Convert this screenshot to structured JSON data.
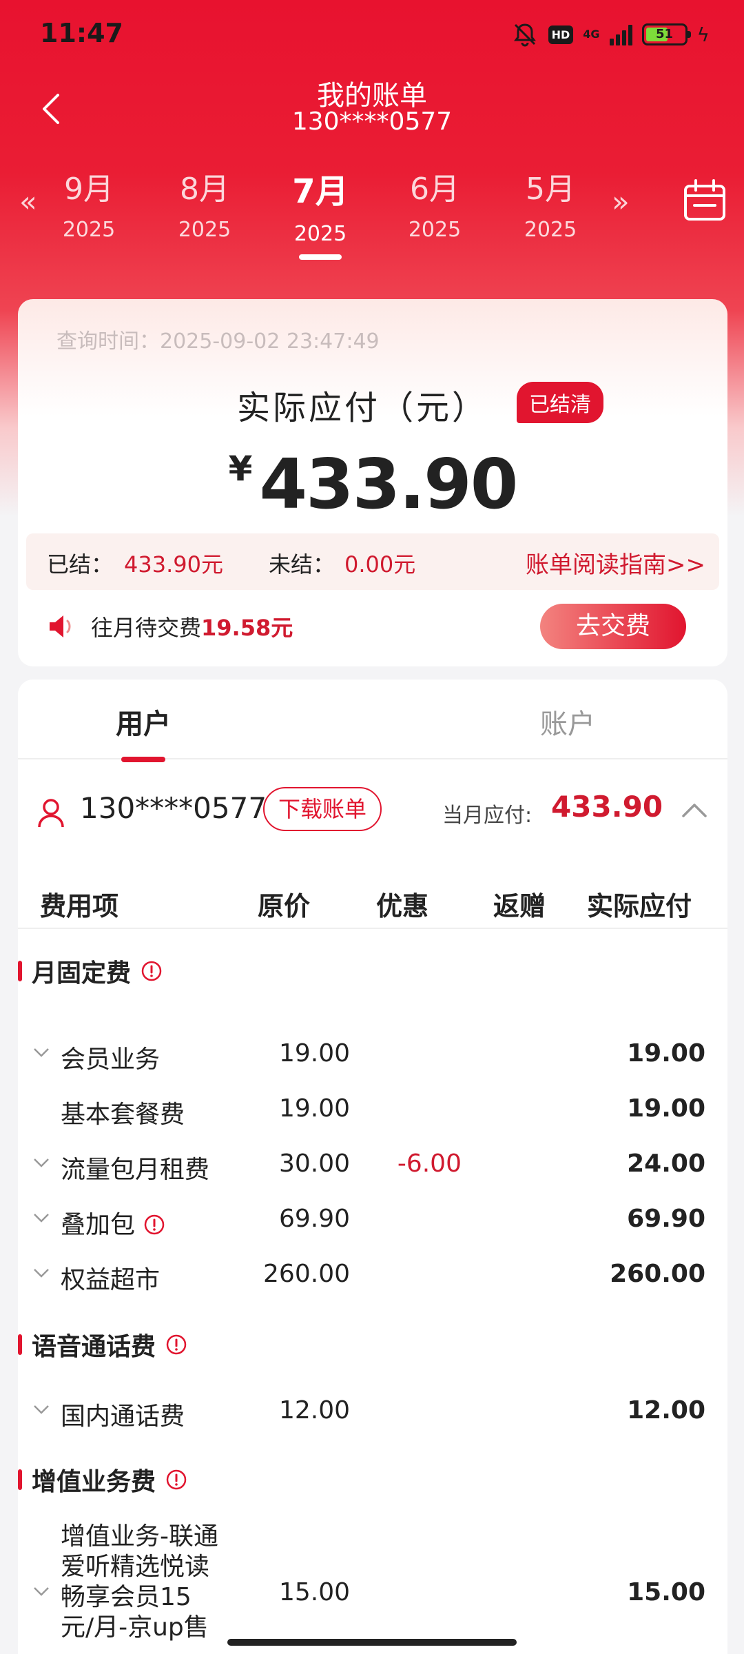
{
  "status": {
    "time": "11:47",
    "hd": "HD",
    "network": "4G",
    "battery": "51"
  },
  "header": {
    "title": "我的账单",
    "subtitle": "130****0577"
  },
  "months": [
    {
      "month": "9月",
      "year": "2025"
    },
    {
      "month": "8月",
      "year": "2025"
    },
    {
      "month": "7月",
      "year": "2025"
    },
    {
      "month": "6月",
      "year": "2025"
    },
    {
      "month": "5月",
      "year": "2025"
    }
  ],
  "nav": {
    "prev": "«",
    "next": "»"
  },
  "summary": {
    "query_time": "查询时间：2025-09-02 23:47:49",
    "pay_label": "实际应付（元）",
    "status_badge": "已结清",
    "currency": "¥",
    "amount": "433.90",
    "settled_label": "已结：",
    "settled_value": "433.90元",
    "unsettled_label": "未结：",
    "unsettled_value": "0.00元",
    "guide": "账单阅读指南>>",
    "notice_prefix": "往月待交费",
    "notice_amount": "19.58元",
    "pay_button": "去交费"
  },
  "tabs": {
    "user": "用户",
    "account": "账户"
  },
  "user": {
    "number": "130****0577",
    "download": "下载账单",
    "due_label": "当月应付:",
    "due_value": "433.90"
  },
  "table_headers": {
    "item": "费用项",
    "orig": "原价",
    "discount": "优惠",
    "gift": "返赠",
    "final": "实际应付"
  },
  "sections": {
    "monthly": {
      "title": "月固定费",
      "rows": [
        {
          "name": "会员业务",
          "orig": "19.00",
          "discount": "",
          "final": "19.00"
        },
        {
          "name": "基本套餐费",
          "orig": "19.00",
          "discount": "",
          "final": "19.00"
        },
        {
          "name": "流量包月租费",
          "orig": "30.00",
          "discount": "-6.00",
          "final": "24.00"
        },
        {
          "name": "叠加包",
          "orig": "69.90",
          "discount": "",
          "final": "69.90"
        },
        {
          "name": "权益超市",
          "orig": "260.00",
          "discount": "",
          "final": "260.00"
        }
      ]
    },
    "voice": {
      "title": "语音通话费",
      "rows": [
        {
          "name": "国内通话费",
          "orig": "12.00",
          "discount": "",
          "final": "12.00"
        }
      ]
    },
    "vas": {
      "title": "增值业务费",
      "rows": [
        {
          "name": "增值业务-联通爱听精选悦读畅享会员15元/月-京up售",
          "orig": "15.00",
          "discount": "",
          "final": "15.00"
        }
      ]
    }
  },
  "colors": {
    "brand": "#e1152f",
    "header_red": "#e8122f"
  }
}
